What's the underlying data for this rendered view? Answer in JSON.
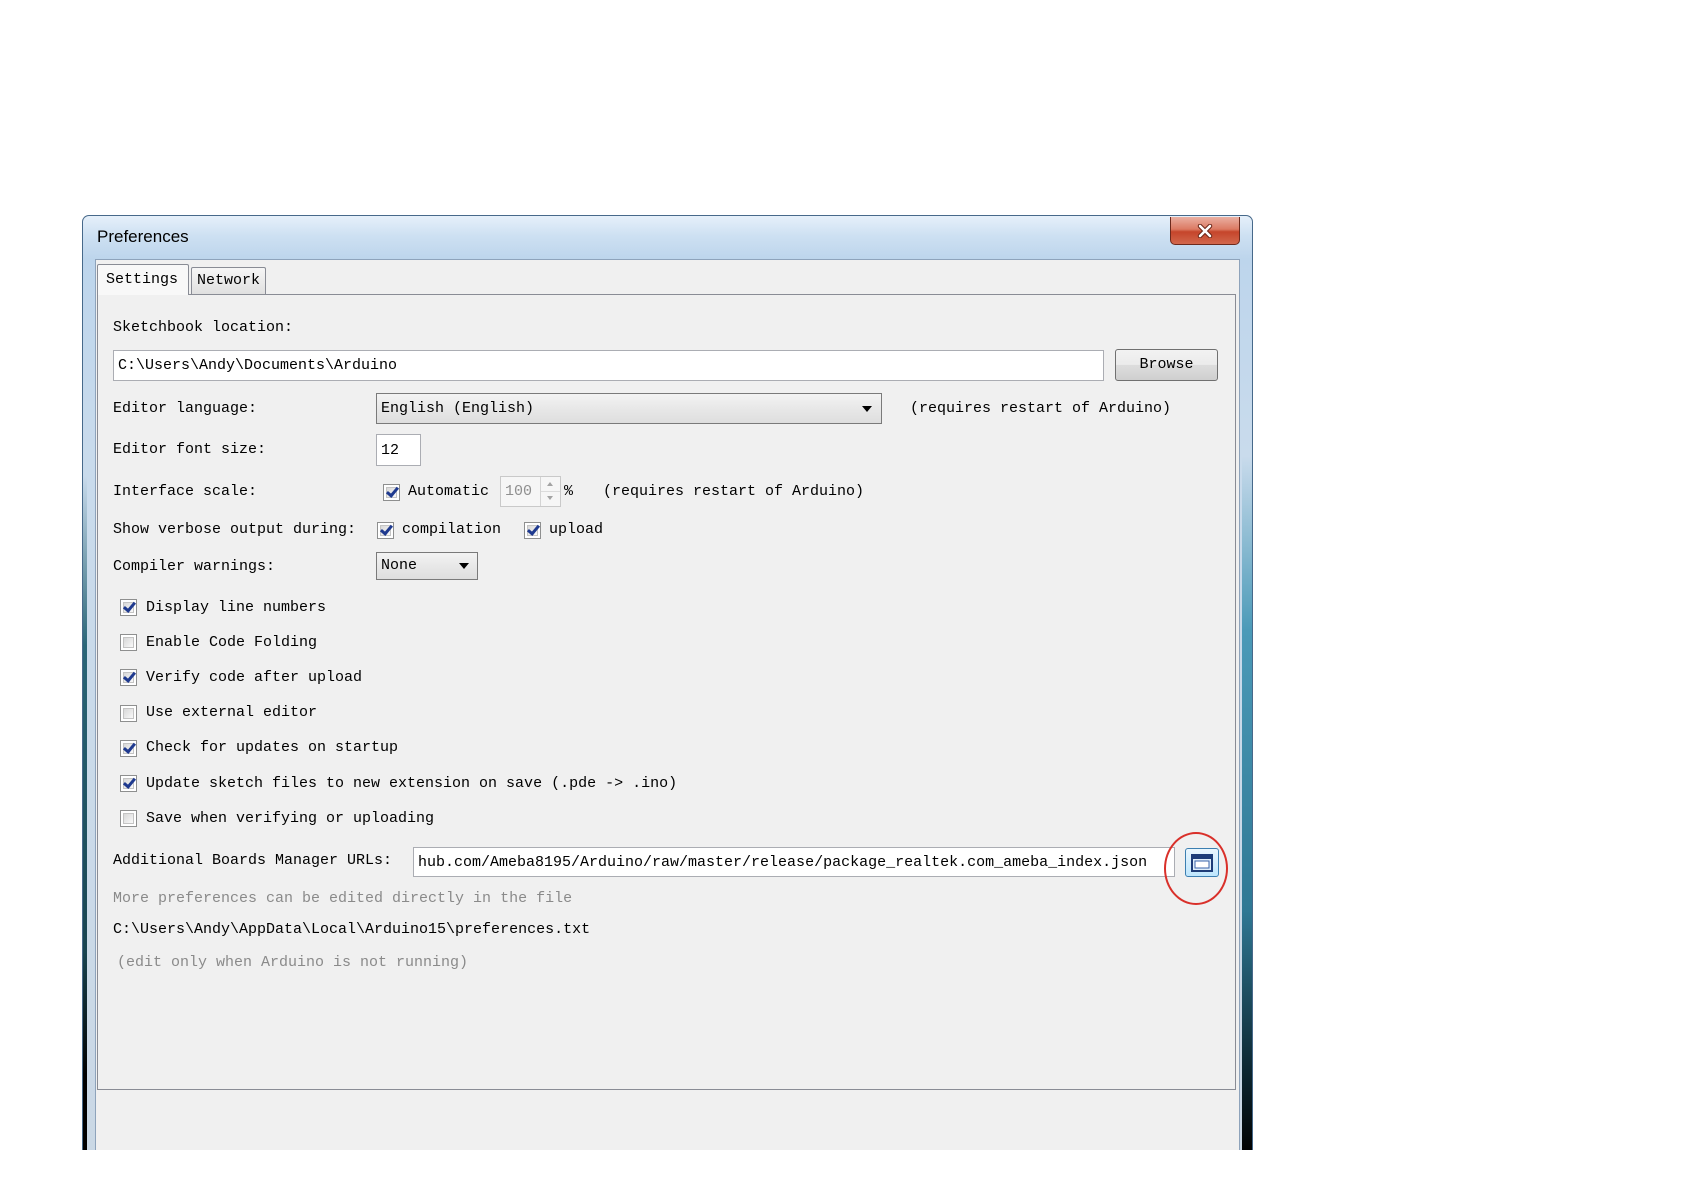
{
  "window": {
    "title": "Preferences"
  },
  "tabs": [
    {
      "label": "Settings",
      "selected": true
    },
    {
      "label": "Network",
      "selected": false
    }
  ],
  "settings": {
    "sketchbook": {
      "label": "Sketchbook location:",
      "value": "C:\\Users\\Andy\\Documents\\Arduino",
      "browse_label": "Browse"
    },
    "editor_language": {
      "label": "Editor language:",
      "selected": "English (English)",
      "note": "(requires restart of Arduino)"
    },
    "font_size": {
      "label": "Editor font size:",
      "value": "12"
    },
    "interface_scale": {
      "label": "Interface scale:",
      "automatic_label": "Automatic",
      "automatic_checked": true,
      "scale_value": "100",
      "unit": "%",
      "note": "(requires restart of Arduino)"
    },
    "verbose": {
      "label": "Show verbose output during:",
      "compilation_label": "compilation",
      "compilation_checked": true,
      "upload_label": "upload",
      "upload_checked": true
    },
    "compiler_warnings": {
      "label": "Compiler warnings:",
      "selected": "None"
    },
    "options": [
      {
        "label": "Display line numbers",
        "checked": true
      },
      {
        "label": "Enable Code Folding",
        "checked": false
      },
      {
        "label": "Verify code after upload",
        "checked": true
      },
      {
        "label": "Use external editor",
        "checked": false
      },
      {
        "label": "Check for updates on startup",
        "checked": true
      },
      {
        "label": "Update sketch files to new extension on save (.pde -> .ino)",
        "checked": true
      },
      {
        "label": "Save when verifying or uploading",
        "checked": false
      }
    ],
    "boards_urls": {
      "label": "Additional Boards Manager URLs:",
      "value": "hub.com/Ameba8195/Arduino/raw/master/release/package_realtek.com_ameba_index.json"
    },
    "more_prefs": "More preferences can be edited directly in the file",
    "prefs_path": "C:\\Users\\Andy\\AppData\\Local\\Arduino15\\preferences.txt",
    "edit_note": "(edit only when Arduino is not running)"
  },
  "icons": {
    "close": "close-icon",
    "dropdown": "chevron-down-icon",
    "spinner_up": "spinner-up-icon",
    "spinner_down": "spinner-down-icon",
    "edit_urls": "window-icon"
  },
  "colors": {
    "highlight": "#d9302a",
    "checkmark": "#1f3a8f",
    "muted_text": "#8a8a8a",
    "title_bar": "#bdd5ec",
    "close_button": "#c5452b"
  }
}
